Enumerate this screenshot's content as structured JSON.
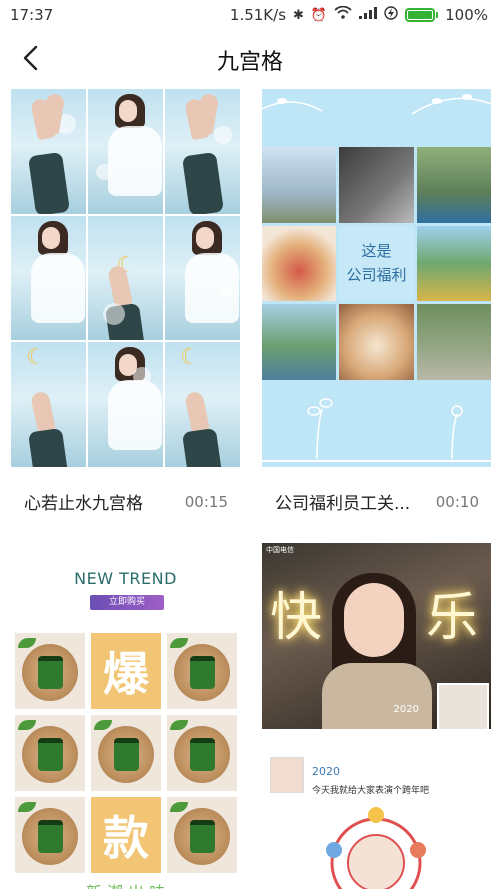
{
  "status_bar": {
    "time": "17:37",
    "network_speed": "1.51K/s",
    "icons": [
      "bluetooth-icon",
      "alarm-icon",
      "wifi-icon",
      "signal-icon",
      "charging-icon"
    ],
    "battery_percent": "100%",
    "battery_level": 1.0
  },
  "header": {
    "back_icon": "chevron-left-icon",
    "title": "九宫格"
  },
  "cards": [
    {
      "title": "心若止水九宫格",
      "duration": "00:15"
    },
    {
      "title": "公司福利员工关...",
      "duration": "00:10",
      "center_text": "这是\n公司福利"
    },
    {
      "trend_title": "NEW TREND",
      "trend_button": "立即购买",
      "big_chars": [
        "爆",
        "款"
      ],
      "footer_text": "新·潮·出·味"
    },
    {
      "phone_carrier": "中国电信",
      "glow_chars": [
        "快",
        "乐"
      ],
      "photo_year": "2020",
      "post_year": "2020",
      "post_text": "今天我就给大家表演个跨年吧"
    }
  ],
  "colors": {
    "accent": "#34b233",
    "card2_bg": "#bfe6f6",
    "trend_orange": "#f2c575",
    "post_blue": "#3a7bb8"
  }
}
